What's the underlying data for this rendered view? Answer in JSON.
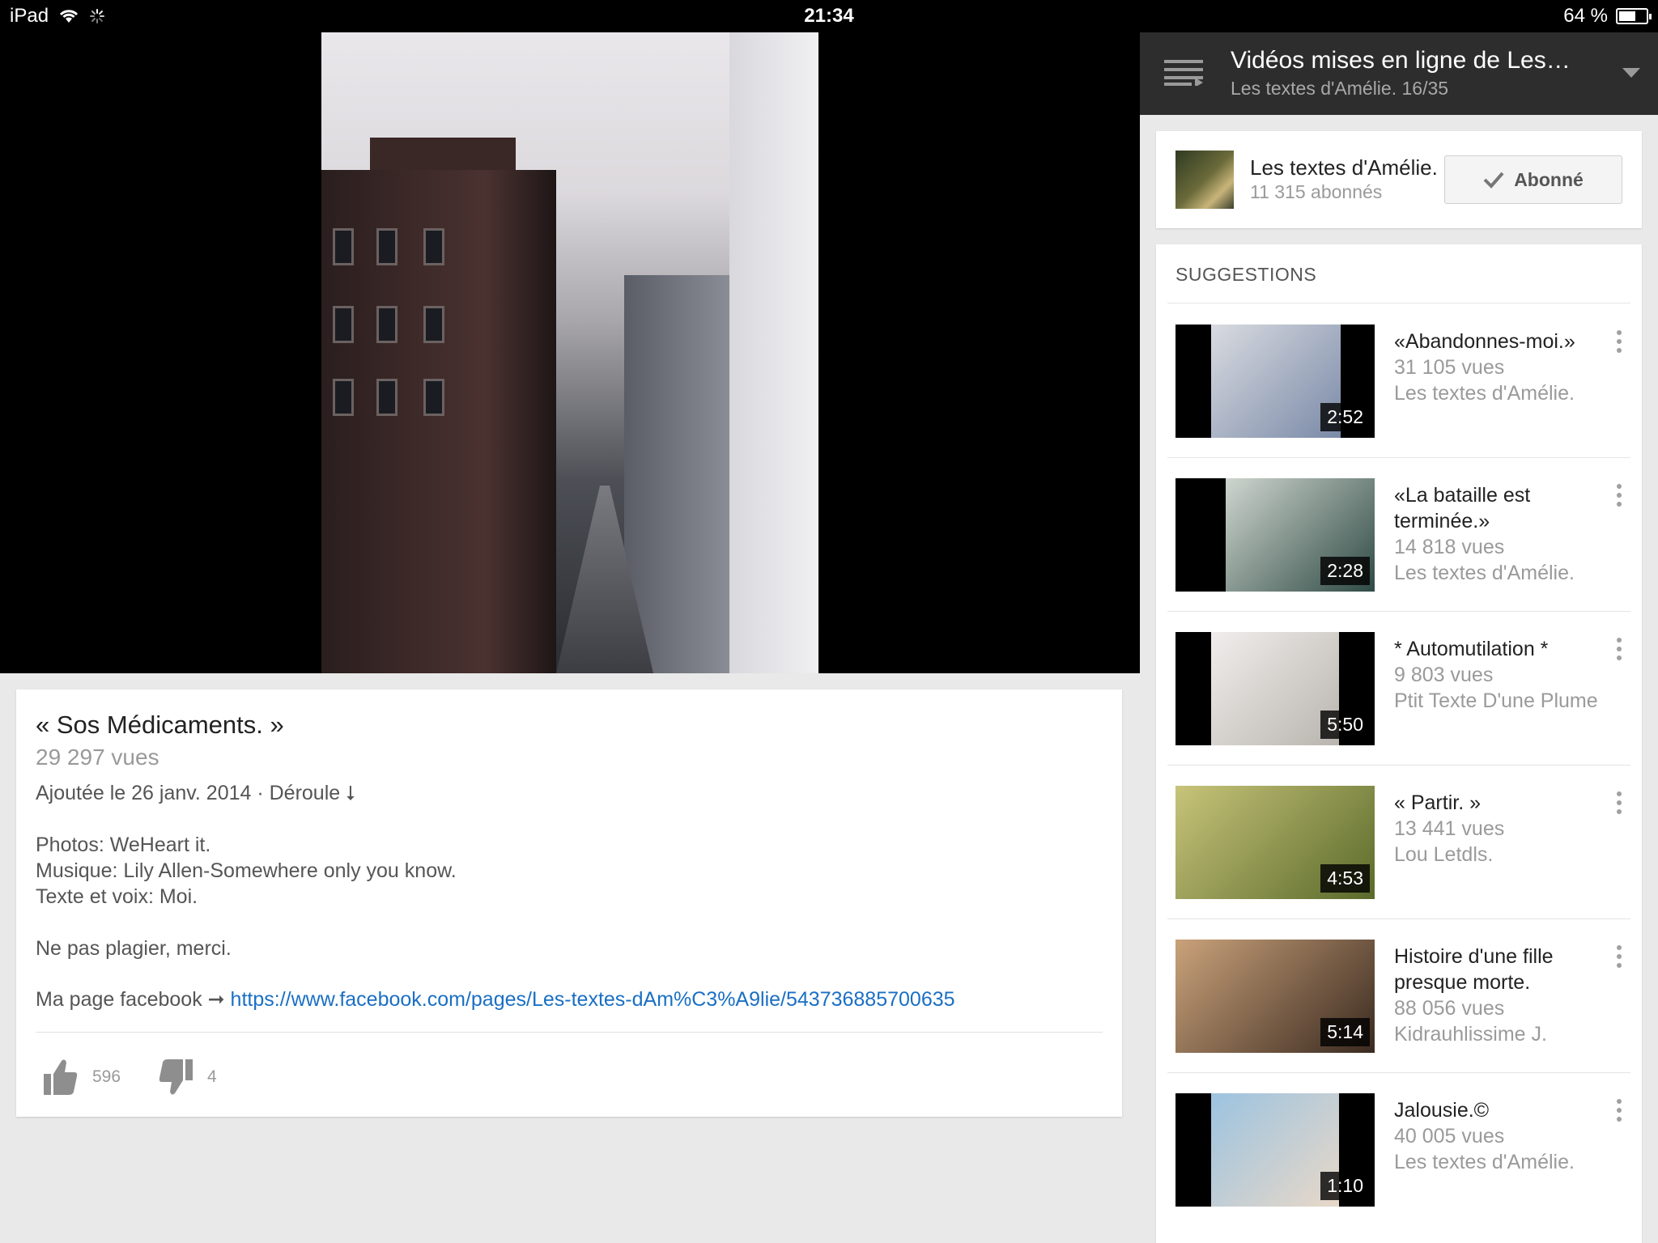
{
  "status_bar": {
    "device": "iPad",
    "time": "21:34",
    "battery": "64 %",
    "battery_level": 0.64
  },
  "video": {
    "title": "« Sos Médicaments. »",
    "views": "29 297 vues",
    "date_line": "Ajoutée le 26 janv. 2014 · Déroule ⭣",
    "description": [
      "Photos: WeHeart it.",
      "Musique: Lily Allen-Somewhere only you know.",
      "Texte et voix: Moi.",
      "",
      "Ne pas plagier, merci."
    ],
    "link_prefix": "Ma page facebook ➞ ",
    "link": "https://www.facebook.com/pages/Les-textes-dAm%C3%A9lie/543736885700635",
    "likes": "596",
    "dislikes": "4"
  },
  "playlist": {
    "title": "Vidéos mises en ligne de Les…",
    "subtitle": "Les textes d'Amélie.  16/35"
  },
  "channel": {
    "name": "Les textes d'Amélie.",
    "subscribers": "11 315 abonnés",
    "subscribe_label": "Abonné"
  },
  "suggestions": {
    "heading": "SUGGESTIONS",
    "items": [
      {
        "title": "«Abandonnes-moi.»",
        "views": "31 105 vues",
        "channel": "Les textes d'Amélie.",
        "duration": "2:52",
        "color_a": "#d9dbe0",
        "color_b": "#7a8aa8"
      },
      {
        "title": "«La bataille est terminée.»",
        "views": "14 818 vues",
        "channel": "Les textes d'Amélie.",
        "duration": "2:28",
        "color_a": "#cfd6cf",
        "color_b": "#2f4a44"
      },
      {
        "title": "* Automutilation *",
        "views": "9 803 vues",
        "channel": "Ptit Texte D'une Plume",
        "duration": "5:50",
        "color_a": "#f0eeec",
        "color_b": "#b9b4ae"
      },
      {
        "title": "« Partir.  »",
        "views": "13 441 vues",
        "channel": "Lou Letdls.",
        "duration": "4:53",
        "color_a": "#c8c47a",
        "color_b": "#5a6a2a"
      },
      {
        "title": "Histoire d'une fille presque morte.",
        "views": "88 056 vues",
        "channel": "Kidrauhlissime J.",
        "duration": "5:14",
        "color_a": "#caa27a",
        "color_b": "#3a2a20"
      },
      {
        "title": "Jalousie.©",
        "views": "40 005 vues",
        "channel": "Les textes d'Amélie.",
        "duration": "1:10",
        "color_a": "#9cc3e0",
        "color_b": "#e8d8c8"
      }
    ]
  }
}
